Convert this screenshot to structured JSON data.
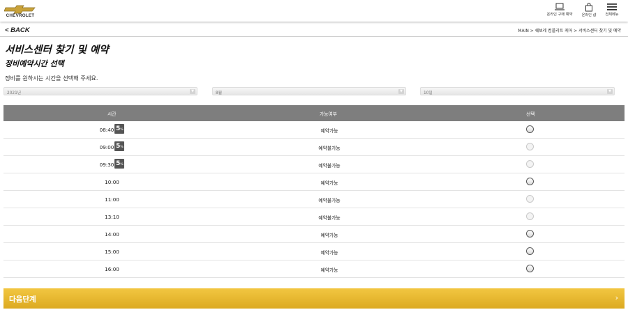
{
  "header": {
    "brand": "CHEVROLET",
    "online_purchase_label": "온라인 구매 예약",
    "online_shop_label": "온라인 샵",
    "menu_label": "전체메뉴",
    "brand_gold": "#d6a42a"
  },
  "nav": {
    "back_label": "< BACK",
    "breadcrumb": "MAIN > 쉐보레 컴플리트 케어 > 서비스센터 찾기 및 예약"
  },
  "page": {
    "title": "서비스센터 찾기 및 예약",
    "section_title": "정비예약시간 선택",
    "instruction": "정비를 원하시는 시간을 선택해 주세요."
  },
  "filters": {
    "year": "2021년",
    "month": "8월",
    "day": "10일"
  },
  "table": {
    "headers": {
      "time": "시간",
      "availability": "가능여부",
      "select": "선택"
    },
    "rows": [
      {
        "time": "08:40",
        "badge": "5",
        "badge_unit": "%",
        "status": "예약가능",
        "available": true
      },
      {
        "time": "09:00",
        "badge": "5",
        "badge_unit": "%",
        "status": "예약불가능",
        "available": false
      },
      {
        "time": "09:30",
        "badge": "5",
        "badge_unit": "%",
        "status": "예약불가능",
        "available": false
      },
      {
        "time": "10:00",
        "badge": "",
        "badge_unit": "",
        "status": "예약가능",
        "available": true
      },
      {
        "time": "11:00",
        "badge": "",
        "badge_unit": "",
        "status": "예약불가능",
        "available": false
      },
      {
        "time": "13:10",
        "badge": "",
        "badge_unit": "",
        "status": "예약불가능",
        "available": false
      },
      {
        "time": "14:00",
        "badge": "",
        "badge_unit": "",
        "status": "예약가능",
        "available": true
      },
      {
        "time": "15:00",
        "badge": "",
        "badge_unit": "",
        "status": "예약가능",
        "available": true
      },
      {
        "time": "16:00",
        "badge": "",
        "badge_unit": "",
        "status": "예약가능",
        "available": true
      }
    ]
  },
  "footer": {
    "next_label": "다음단계",
    "next_chevron": "›",
    "accent": "#e6b630"
  }
}
